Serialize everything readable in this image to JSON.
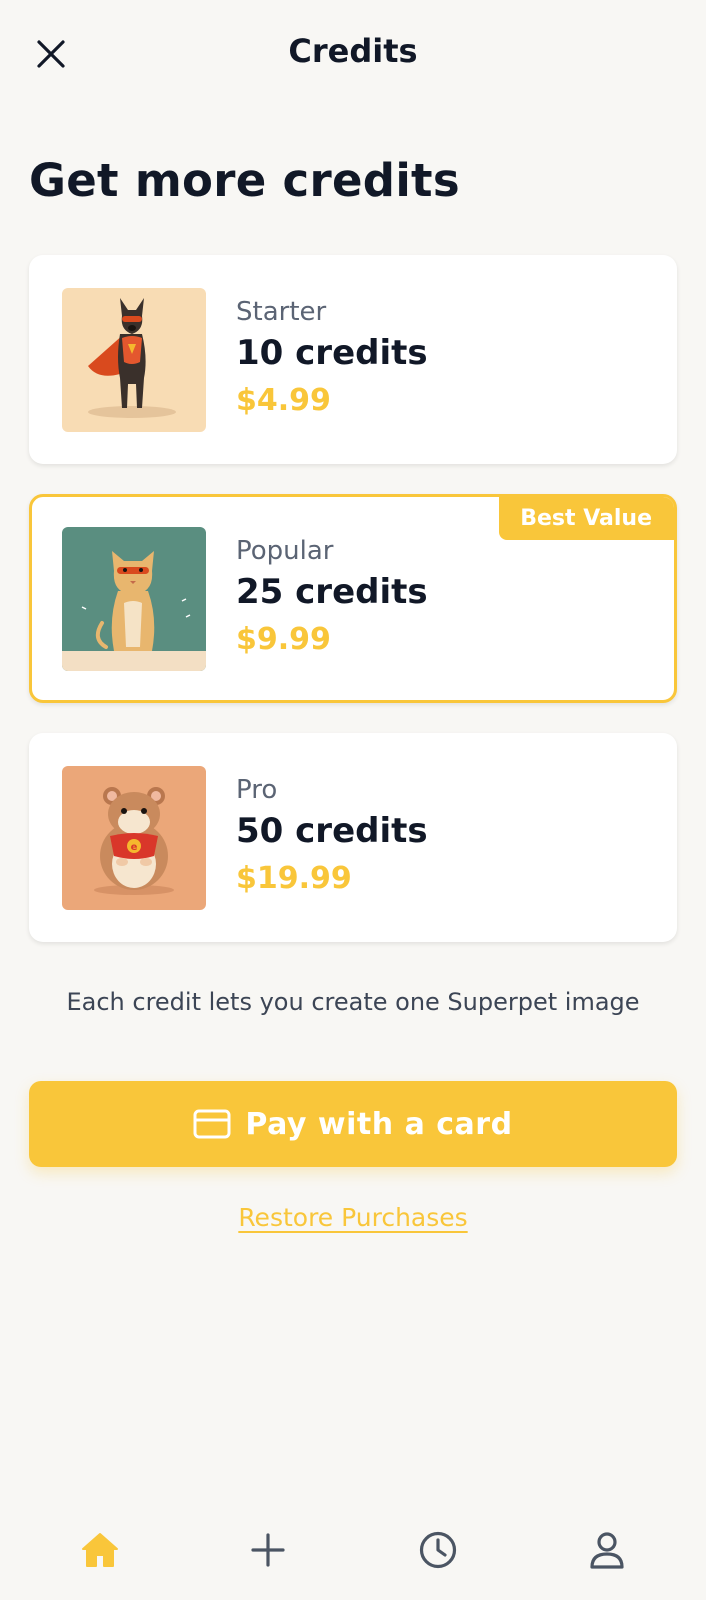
{
  "header": {
    "title": "Credits",
    "close_icon": "close-icon"
  },
  "page_heading": "Get more credits",
  "packs": [
    {
      "name": "Starter",
      "credits": "10 credits",
      "price": "$4.99",
      "image": "superhero-dog-illustration",
      "image_bg": "#f8dcb4",
      "featured": false
    },
    {
      "name": "Popular",
      "credits": "25 credits",
      "price": "$9.99",
      "image": "superhero-cat-illustration",
      "image_bg": "#5a8e80",
      "featured": true,
      "badge": "Best Value"
    },
    {
      "name": "Pro",
      "credits": "50 credits",
      "price": "$19.99",
      "image": "superhero-hamster-illustration",
      "image_bg": "#eba779",
      "featured": false
    }
  ],
  "info_text": "Each credit lets you create one Superpet image",
  "pay_button": {
    "label": "Pay with a card",
    "icon": "credit-card-icon"
  },
  "restore_link": "Restore Purchases",
  "bottom_nav": {
    "items": [
      {
        "icon": "home-icon",
        "active": true
      },
      {
        "icon": "plus-icon",
        "active": false
      },
      {
        "icon": "clock-icon",
        "active": false
      },
      {
        "icon": "user-icon",
        "active": false
      }
    ]
  },
  "colors": {
    "accent": "#f9c63a",
    "background": "#f8f7f4",
    "text_primary": "#111827",
    "text_secondary": "#5b6474",
    "nav_inactive": "#4b5563"
  }
}
